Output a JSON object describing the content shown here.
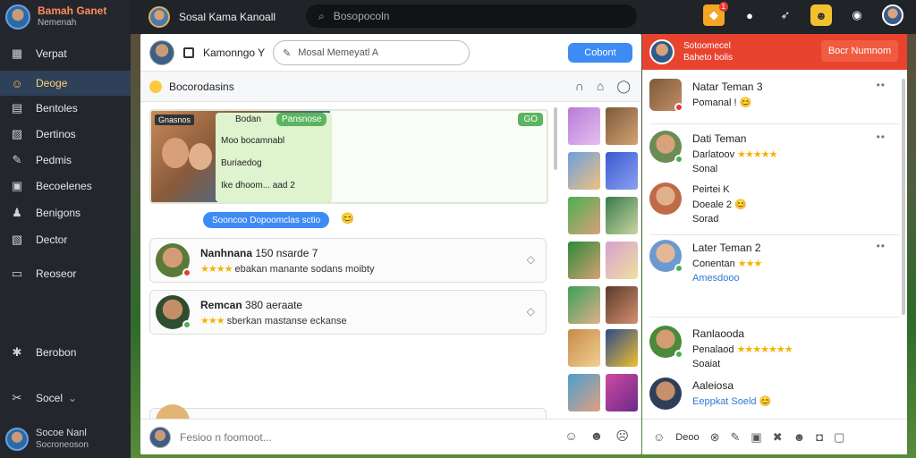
{
  "sidebar": {
    "brand_title": "Bamah Ganet",
    "brand_subtitle": "Nemenah",
    "items": [
      {
        "label": "Verpat",
        "icon": "grid-icon"
      },
      {
        "label": "Deoge",
        "icon": "smile-icon",
        "active": true
      },
      {
        "label": "Bentoles",
        "icon": "inbox-icon"
      },
      {
        "label": "Dertinos",
        "icon": "edit-icon"
      },
      {
        "label": "Pedmis",
        "icon": "pencil-icon"
      },
      {
        "label": "Becoelenes",
        "icon": "bookmark-icon"
      },
      {
        "label": "Benigons",
        "icon": "person-icon"
      },
      {
        "label": "Dector",
        "icon": "image-icon"
      },
      {
        "label": "Reoseor",
        "icon": "box-icon"
      },
      {
        "label": "Berobon",
        "icon": "star-icon"
      },
      {
        "label": "Socel",
        "icon": "tools-icon"
      }
    ],
    "user_name": "Socoe Nanl",
    "user_sub": "Socroneoson"
  },
  "topbar": {
    "title": "Sosal Kama Kanoall",
    "search_placeholder": "Bosopocoln",
    "notification_count": "1"
  },
  "center": {
    "header_name": "Kamonngo Y",
    "input_value": "Mosal Memeyatl A",
    "button_label": "Cobont",
    "subheader": "Bocorodasins",
    "card": {
      "tag1": "Gnasnos",
      "tag2": "Bodan",
      "tag3": "Pansnose",
      "tag4": "GO",
      "line1": "Moo bocamnabl",
      "line2": "Buriaedog",
      "line3": "Ike dhoom... aad 2"
    },
    "pill_text": "Sooncoo Dopoomclas sctio",
    "rows": [
      {
        "name": "Nanhnana",
        "meta": "150 nsarde 7",
        "sub": "ebakan manante sodans moibty",
        "stars": "★★★★",
        "dot": "#e53935"
      },
      {
        "name": "Remcan",
        "meta": "380 aeraate",
        "sub": "sberkan mastanse eckanse",
        "stars": "★★★",
        "dot": "#4caf50"
      }
    ],
    "footer_placeholder": "Fesioo n foomoot..."
  },
  "right": {
    "header_title": "Sotoomecel",
    "header_sub": "Baheto bolis",
    "header_button": "Bocr Numnom",
    "items": [
      {
        "name": "Natar Teman 3",
        "line2": "Pomanal !",
        "line3": "",
        "stars": ""
      },
      {
        "name": "Dati Teman",
        "line2": "Darlatoov",
        "line3": "Sonal",
        "stars": "★★★★★"
      },
      {
        "name": "Peirtei K",
        "line2": "Doeale 2",
        "line3": "Sorad",
        "stars": ""
      },
      {
        "name": "Later Teman 2",
        "line2": "Conentan",
        "line3": "Amesdooo",
        "stars": "★★★"
      },
      {
        "name": "Ranlaooda",
        "line2": "Penalaod",
        "line3": "Soaiat",
        "stars": "★★★★★★★"
      },
      {
        "name": "Aaleiosa",
        "line2": "Eeppkat Soeld",
        "line3": "",
        "stars": ""
      }
    ],
    "footer_label": "Deoo"
  }
}
